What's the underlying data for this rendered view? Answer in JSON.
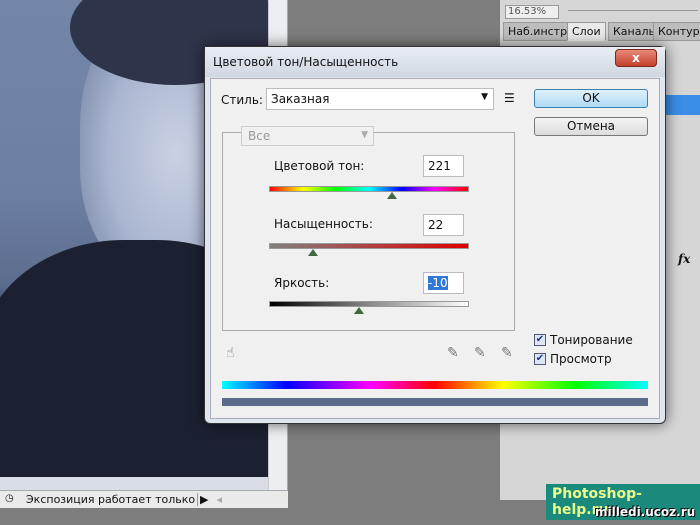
{
  "document": {
    "status_text": "Экспозиция работает только в ..."
  },
  "panel": {
    "zoom": "16.53%",
    "tabs": [
      {
        "label": "Наб.инстр",
        "active": false
      },
      {
        "label": "Слои",
        "active": true
      },
      {
        "label": "Каналы",
        "active": false
      },
      {
        "label": "Контур",
        "active": false
      }
    ],
    "fx_label": "fx"
  },
  "dialog": {
    "title": "Цветовой тон/Насыщенность",
    "close_label": "x",
    "style_label": "Стиль:",
    "style_value": "Заказная",
    "ok_label": "OK",
    "cancel_label": "Отмена",
    "channel_value": "Все",
    "hue": {
      "label": "Цветовой тон:",
      "value": "221",
      "fraction": 0.614
    },
    "saturation": {
      "label": "Насыщенность:",
      "value": "22",
      "fraction": 0.22
    },
    "lightness": {
      "label": "Яркость:",
      "value": "-10",
      "fraction": 0.45
    },
    "colorize": {
      "label": "Тонирование",
      "checked": true
    },
    "preview": {
      "label": "Просмотр",
      "checked": true
    },
    "result_color": "#5a6a88"
  },
  "watermark": {
    "site1": "Photoshop-help.ru",
    "site2": "milledi.ucoz.ru"
  }
}
